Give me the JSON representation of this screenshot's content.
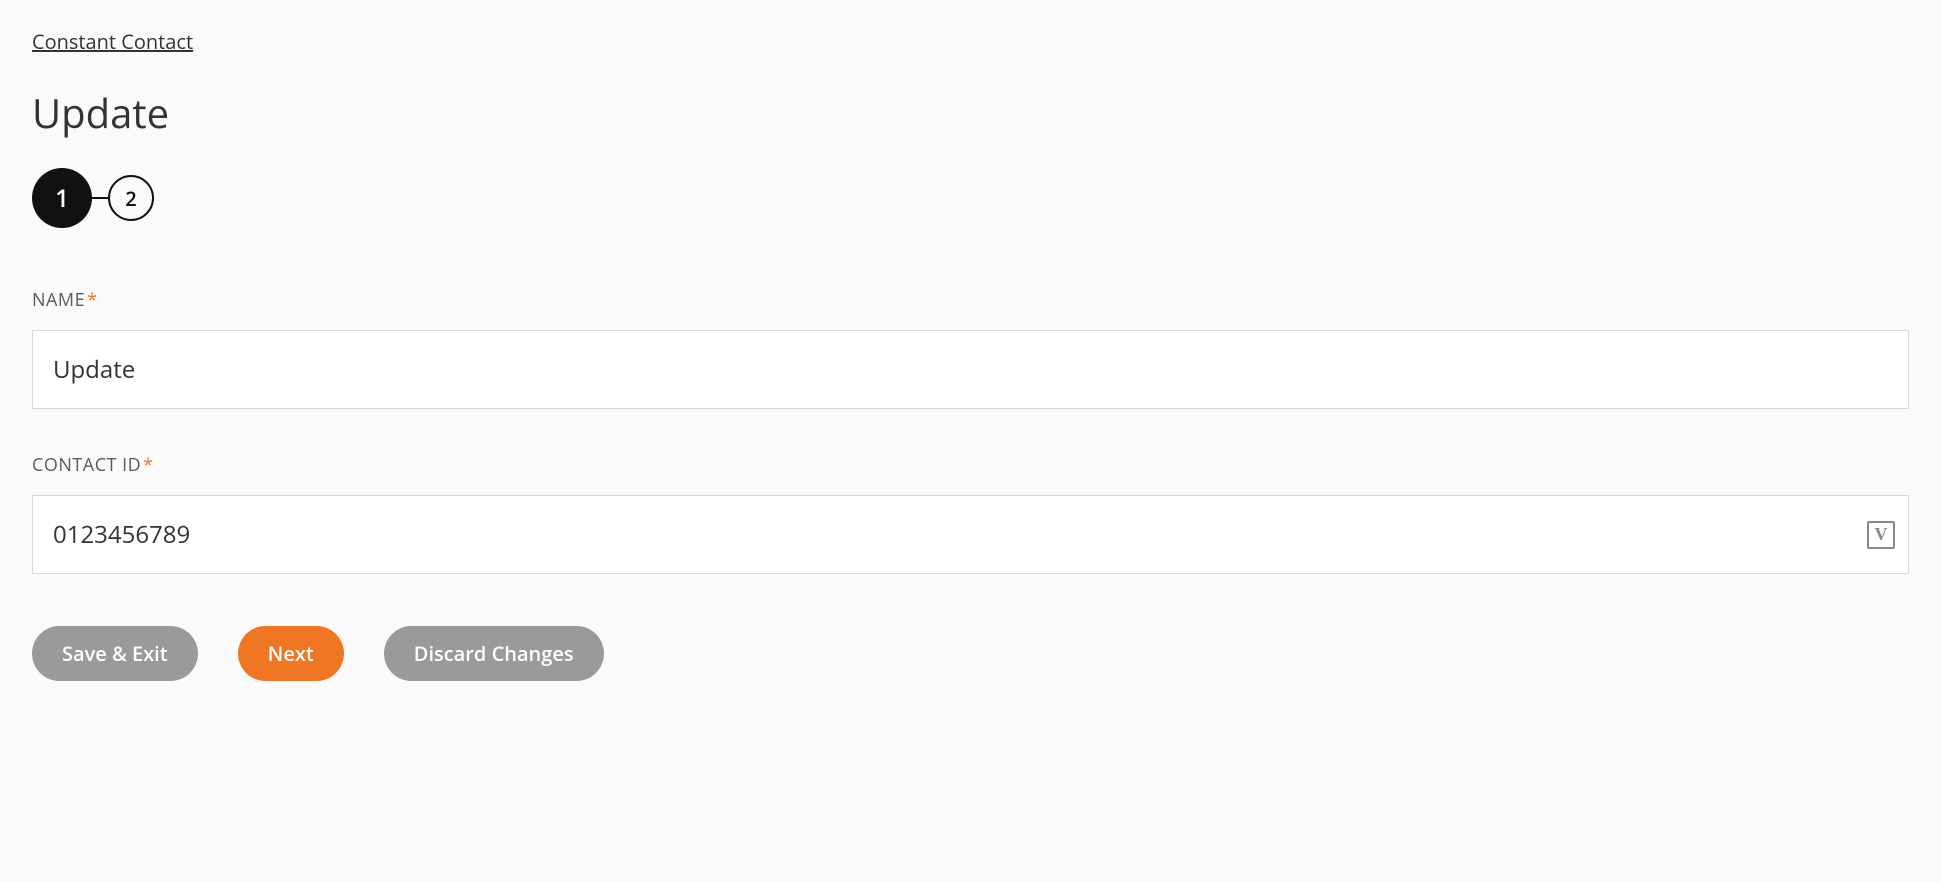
{
  "breadcrumb": {
    "label": "Constant Contact"
  },
  "page": {
    "title": "Update"
  },
  "stepper": {
    "steps": [
      {
        "number": "1",
        "active": true
      },
      {
        "number": "2",
        "active": false
      }
    ]
  },
  "form": {
    "name": {
      "label": "NAME",
      "required_mark": "*",
      "value": "Update"
    },
    "contact_id": {
      "label": "CONTACT ID",
      "required_mark": "*",
      "value": "0123456789",
      "variable_badge": "V"
    }
  },
  "buttons": {
    "save_exit": "Save & Exit",
    "next": "Next",
    "discard": "Discard Changes"
  }
}
